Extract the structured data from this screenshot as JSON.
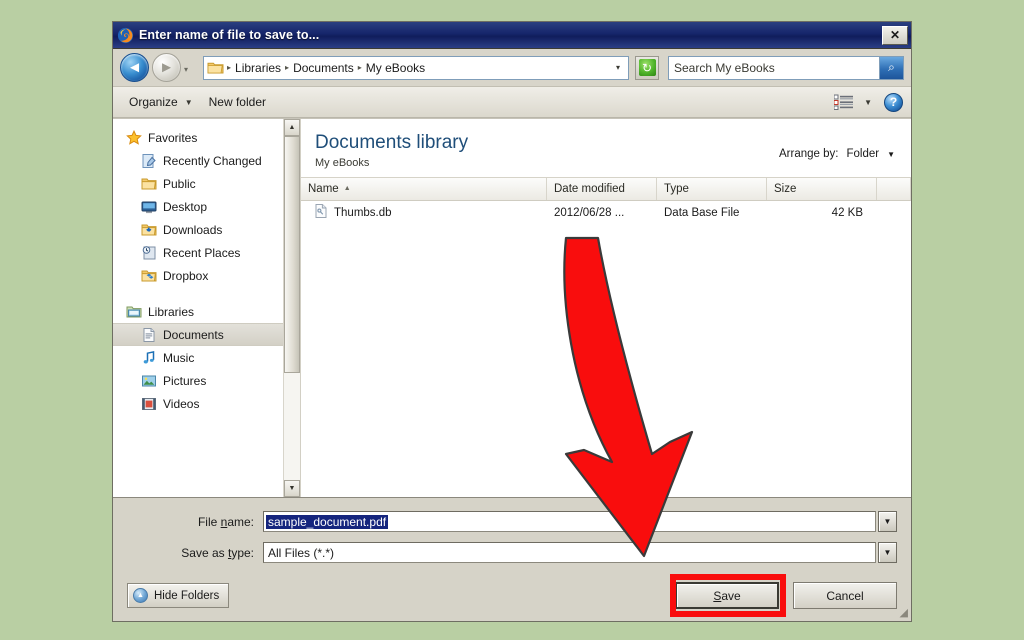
{
  "window": {
    "title": "Enter name of file to save to...",
    "app_icon": "firefox-icon",
    "close_label": "✕"
  },
  "addressbar": {
    "back_icon": "back-arrow-icon",
    "back_glyph": "◄",
    "forward_icon": "forward-arrow-icon",
    "forward_glyph": "►",
    "history_chevron": "▾",
    "folder_icon": "folder-icon",
    "breadcrumbs": [
      "Libraries",
      "Documents",
      "My eBooks"
    ],
    "separator": "▸",
    "dropdown_chevron": "▾",
    "refresh_icon": "refresh-icon",
    "refresh_glyph": "↻",
    "search_value": "Search My eBooks",
    "search_placeholder": "Search My eBooks",
    "search_icon": "magnifier-icon",
    "search_glyph": "⌕"
  },
  "toolbar": {
    "organize_label": "Organize",
    "organize_chevron": "▼",
    "new_folder_label": "New folder",
    "view_icon": "list-view-icon",
    "view_chevron": "▼",
    "help_icon": "help-icon",
    "help_glyph": "?"
  },
  "navpane": {
    "groups": [
      {
        "header": {
          "label": "Favorites",
          "icon": "star-icon"
        },
        "items": [
          {
            "label": "Recently Changed",
            "icon": "recently-changed-icon",
            "selected": false
          },
          {
            "label": "Public",
            "icon": "folder-icon",
            "selected": false
          },
          {
            "label": "Desktop",
            "icon": "desktop-icon",
            "selected": false
          },
          {
            "label": "Downloads",
            "icon": "downloads-icon",
            "selected": false
          },
          {
            "label": "Recent Places",
            "icon": "recent-places-icon",
            "selected": false
          },
          {
            "label": "Dropbox",
            "icon": "dropbox-icon",
            "selected": false
          }
        ]
      },
      {
        "header": {
          "label": "Libraries",
          "icon": "libraries-icon"
        },
        "items": [
          {
            "label": "Documents",
            "icon": "documents-icon",
            "selected": true
          },
          {
            "label": "Music",
            "icon": "music-icon",
            "selected": false
          },
          {
            "label": "Pictures",
            "icon": "pictures-icon",
            "selected": false
          },
          {
            "label": "Videos",
            "icon": "videos-icon",
            "selected": false
          }
        ]
      }
    ],
    "scroll_up": "▲",
    "scroll_down": "▼"
  },
  "content": {
    "library_title": "Documents library",
    "library_subtitle": "My eBooks",
    "arrange_label": "Arrange by:",
    "arrange_value": "Folder",
    "arrange_chevron": "▼",
    "columns": [
      {
        "label": "Name",
        "sort": "▲"
      },
      {
        "label": "Date modified",
        "sort": ""
      },
      {
        "label": "Type",
        "sort": ""
      },
      {
        "label": "Size",
        "sort": ""
      }
    ],
    "rows": [
      {
        "icon": "file-icon",
        "name": "Thumbs.db",
        "date_modified": "2012/06/28 ...",
        "type": "Data Base File",
        "size": "42 KB"
      }
    ]
  },
  "form": {
    "filename_label_pre": "File ",
    "filename_label_key": "n",
    "filename_label_post": "ame:",
    "filename_value": "sample_document.pdf",
    "filetype_label_pre": "Save as ",
    "filetype_label_key": "t",
    "filetype_label_post": "ype:",
    "filetype_value": "All Files (*.*)",
    "dropdown_glyph": "▼"
  },
  "buttons": {
    "hide_folders_label": "Hide Folders",
    "hide_folders_icon": "collapse-icon",
    "hide_folders_glyph": "▲",
    "save_label_pre": "",
    "save_label_key": "S",
    "save_label_post": "ave",
    "cancel_label": "Cancel"
  },
  "annotation": {
    "arrow_icon": "red-down-arrow-annotation",
    "arrow_color": "#f90d0d",
    "highlight_color": "#f90d0d",
    "highlight_target": "save-button"
  },
  "theme": {
    "page_background": "#b9cfa3",
    "dialog_face": "#d6d3c8",
    "titlebar": "#16256b",
    "library_title_color": "#1f4e79",
    "selection_color": "#15257e"
  }
}
